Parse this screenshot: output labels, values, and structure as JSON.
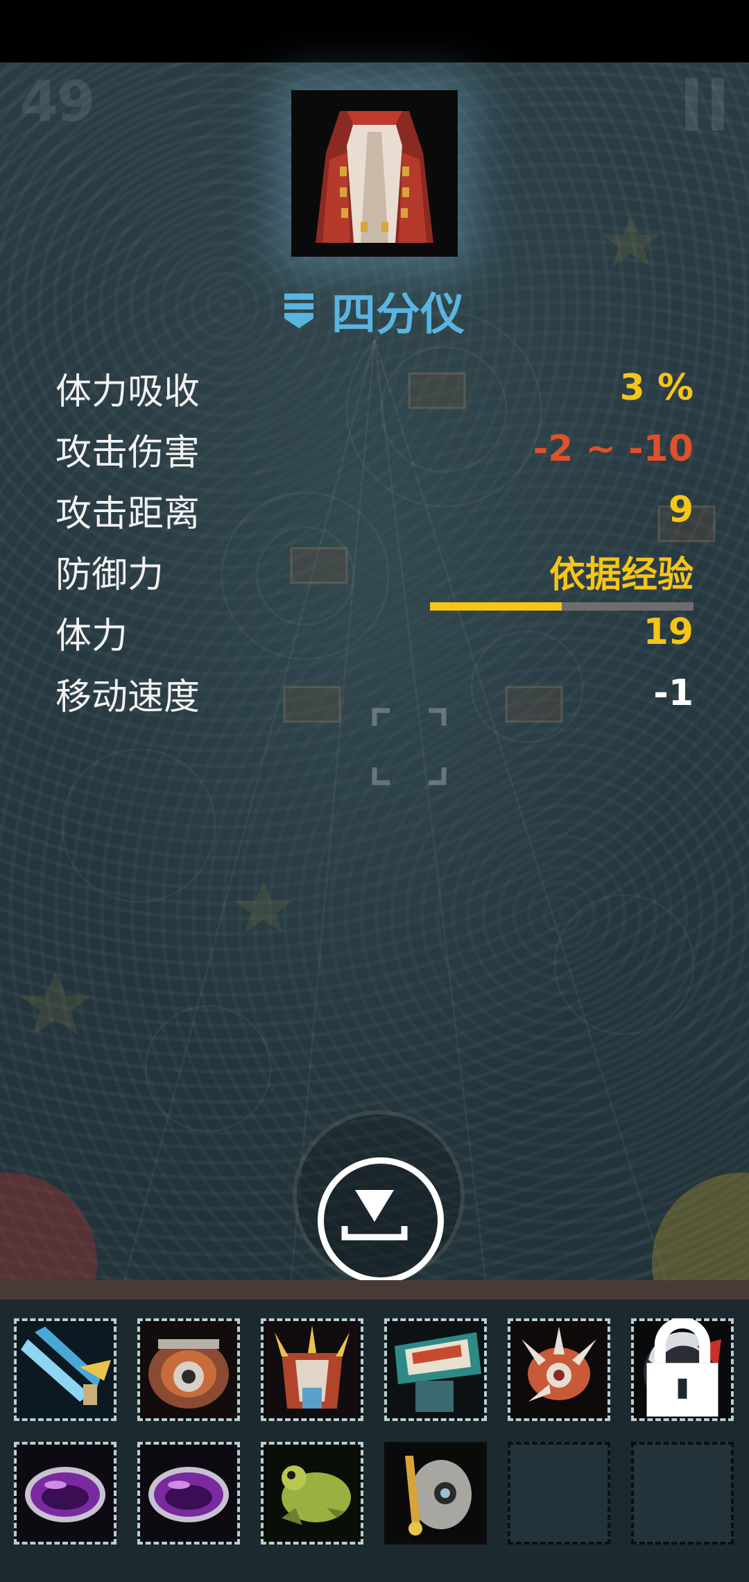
{
  "hud": {
    "turn_counter": "49",
    "pause_icon": "pause-icon"
  },
  "item": {
    "portrait_icon": "red-white-robe-icon",
    "rank_icon": "rank-chevron-icon",
    "name": "四分仪"
  },
  "stats": [
    {
      "label": "体力吸收",
      "value": "3 %",
      "color": "#f5c518"
    },
    {
      "label": "攻击伤害",
      "value": "-2 ~ -10",
      "color": "#e0502a"
    },
    {
      "label": "攻击距离",
      "value": "9",
      "color": "#f5c518"
    },
    {
      "label": "防御力",
      "value": "依据经验",
      "color": "#f5c518",
      "progress": 0.5
    },
    {
      "label": "体力",
      "value": "19",
      "color": "#f5c518"
    },
    {
      "label": "移动速度",
      "value": "-1",
      "color": "#ffffff"
    }
  ],
  "actions": {
    "drop_icon": "drop-item-icon"
  },
  "inventory": {
    "slots": [
      {
        "icon": "ice-blade-icon",
        "empty": false
      },
      {
        "icon": "bronze-gauntlet-icon",
        "empty": false
      },
      {
        "icon": "spiked-armor-icon",
        "empty": false
      },
      {
        "icon": "teal-cloak-icon",
        "empty": false
      },
      {
        "icon": "spiked-helmet-icon",
        "empty": false
      },
      {
        "icon": "dark-orb-icon",
        "empty": false,
        "locked": true
      },
      {
        "icon": "purple-ring-icon",
        "empty": false
      },
      {
        "icon": "purple-ring-icon",
        "empty": false
      },
      {
        "icon": "green-creature-icon",
        "empty": false
      },
      {
        "icon": "skull-mask-icon",
        "empty": false
      },
      {
        "icon": "empty-slot",
        "empty": true
      },
      {
        "icon": "empty-slot",
        "empty": true
      }
    ]
  },
  "colors": {
    "title_blue": "#5ab4e0",
    "value_yellow": "#f5c518",
    "value_red": "#e0502a"
  }
}
